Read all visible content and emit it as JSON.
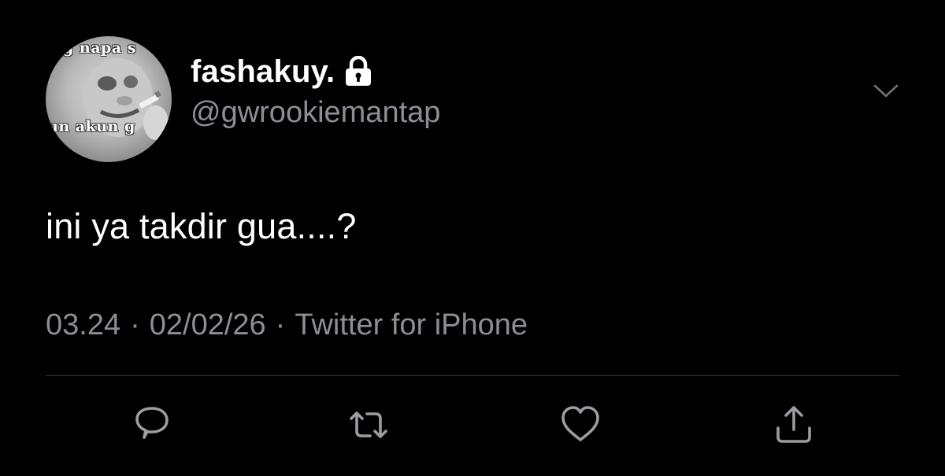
{
  "user": {
    "display_name": "fashakuy.",
    "handle": "@gwrookiemantap",
    "avatar": {
      "caption_top": "g napa s",
      "caption_bottom": "un akun g"
    }
  },
  "tweet": {
    "text": "ini ya takdir gua....?",
    "time": "03.24",
    "date": "02/02/26",
    "source": "Twitter for iPhone",
    "separator": "·"
  },
  "icons": {
    "lock": "lock-icon",
    "menu": "chevron-down-icon",
    "reply": "reply-icon",
    "retweet": "retweet-icon",
    "like": "heart-icon",
    "share": "share-icon"
  },
  "colors": {
    "background": "#000000",
    "text": "#ffffff",
    "secondary": "#8b8f94",
    "divider": "#2f3336"
  }
}
